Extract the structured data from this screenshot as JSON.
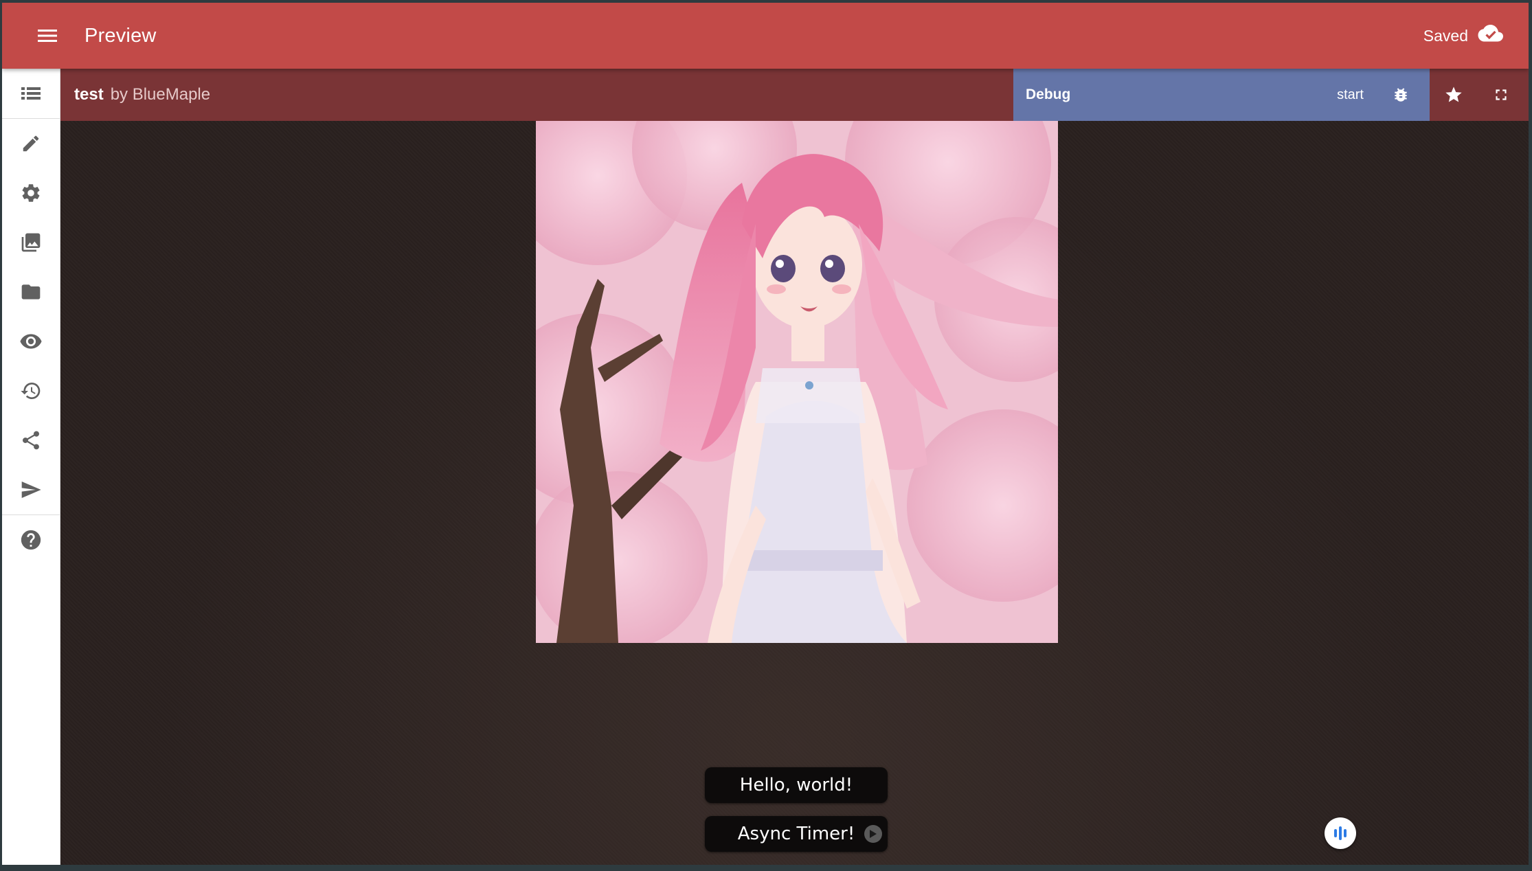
{
  "appbar": {
    "title": "Preview",
    "status": "Saved",
    "menu_icon": "menu-icon",
    "status_icon": "cloud-done-icon",
    "color": "#c24a48"
  },
  "rail": {
    "items": [
      {
        "icon": "list-icon"
      },
      {
        "icon": "pencil-icon"
      },
      {
        "icon": "gear-icon"
      },
      {
        "icon": "image-library-icon"
      },
      {
        "icon": "folder-icon"
      },
      {
        "icon": "eye-icon"
      },
      {
        "icon": "history-icon"
      },
      {
        "icon": "share-icon"
      },
      {
        "icon": "send-icon"
      },
      {
        "icon": "help-icon"
      }
    ]
  },
  "story": {
    "name": "test",
    "author": "by BlueMaple"
  },
  "debug": {
    "label": "Debug",
    "start": "start",
    "color": "#6475a8"
  },
  "toolbar": {
    "star_icon": "star-icon",
    "fullscreen_icon": "fullscreen-icon"
  },
  "choices": [
    {
      "label": "Hello, world!"
    },
    {
      "label": "Async Timer!"
    }
  ]
}
